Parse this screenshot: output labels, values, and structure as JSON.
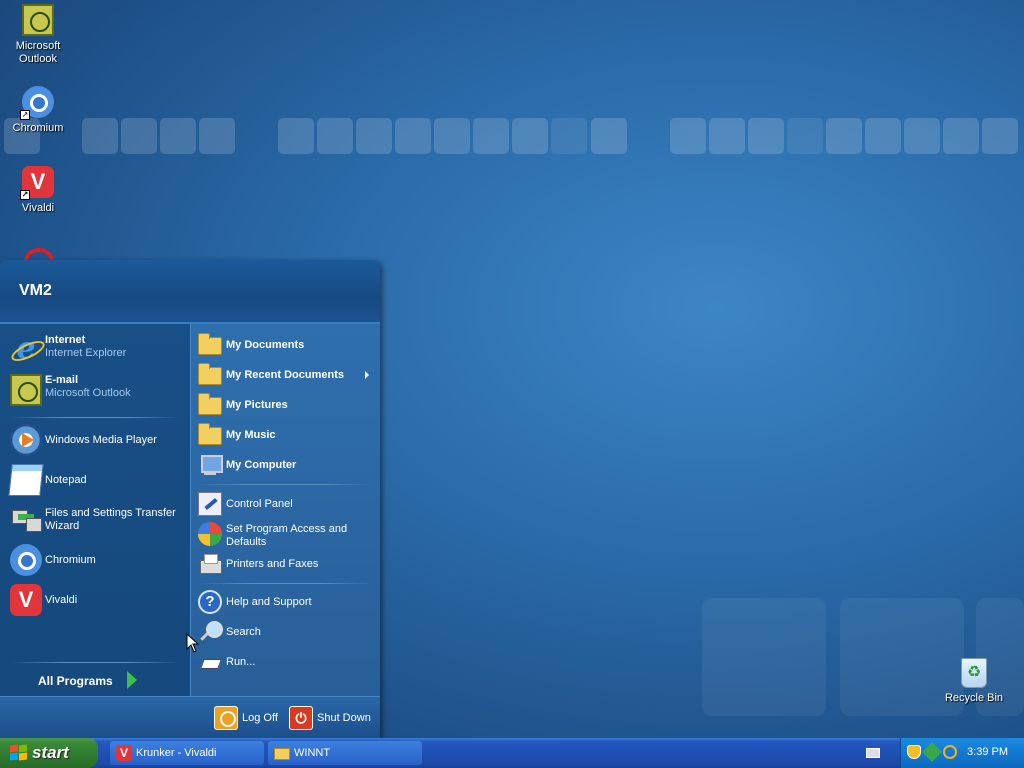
{
  "desktop": {
    "icons": [
      {
        "label": "Microsoft Outlook",
        "icon": "outlook-icon"
      },
      {
        "label": "Chromium",
        "icon": "chromium-icon"
      },
      {
        "label": "Vivaldi",
        "icon": "vivaldi-icon"
      },
      {
        "label": "Recycle Bin",
        "icon": "recycle-bin-icon"
      }
    ]
  },
  "start_menu": {
    "user_name": "VM2",
    "pinned": [
      {
        "title": "Internet",
        "subtitle": "Internet Explorer",
        "icon": "internet-explorer-icon"
      },
      {
        "title": "E-mail",
        "subtitle": "Microsoft Outlook",
        "icon": "outlook-icon"
      }
    ],
    "recent": [
      {
        "label": "Windows Media Player",
        "icon": "media-player-icon"
      },
      {
        "label": "Notepad",
        "icon": "notepad-icon"
      },
      {
        "label": "Files and Settings Transfer Wizard",
        "icon": "transfer-wizard-icon"
      },
      {
        "label": "Chromium",
        "icon": "chromium-icon"
      },
      {
        "label": "Vivaldi",
        "icon": "vivaldi-icon"
      }
    ],
    "all_programs": "All Programs",
    "places": [
      {
        "label": "My Documents",
        "icon": "folder-icon"
      },
      {
        "label": "My Recent Documents",
        "icon": "recent-documents-icon"
      },
      {
        "label": "My Pictures",
        "icon": "folder-icon"
      },
      {
        "label": "My Music",
        "icon": "folder-icon"
      },
      {
        "label": "My Computer",
        "icon": "computer-icon"
      }
    ],
    "settings": [
      {
        "label": "Control Panel",
        "icon": "control-panel-icon"
      },
      {
        "label": "Set Program Access and Defaults",
        "icon": "program-defaults-icon"
      },
      {
        "label": "Printers and Faxes",
        "icon": "printer-icon"
      }
    ],
    "tools": [
      {
        "label": "Help and Support",
        "icon": "help-icon"
      },
      {
        "label": "Search",
        "icon": "search-icon"
      },
      {
        "label": "Run...",
        "icon": "run-icon"
      }
    ],
    "log_off": "Log Off",
    "shut_down": "Shut Down"
  },
  "taskbar": {
    "start_label": "start",
    "buttons": [
      {
        "label": "Krunker - Vivaldi",
        "icon": "vivaldi-icon"
      },
      {
        "label": "WINNT",
        "icon": "folder-icon"
      }
    ],
    "clock": "3:39 PM"
  },
  "colors": {
    "desktop_blue": "#2a6aa8",
    "taskbar_blue": "#2050b4",
    "start_green": "#2f7a2f"
  }
}
